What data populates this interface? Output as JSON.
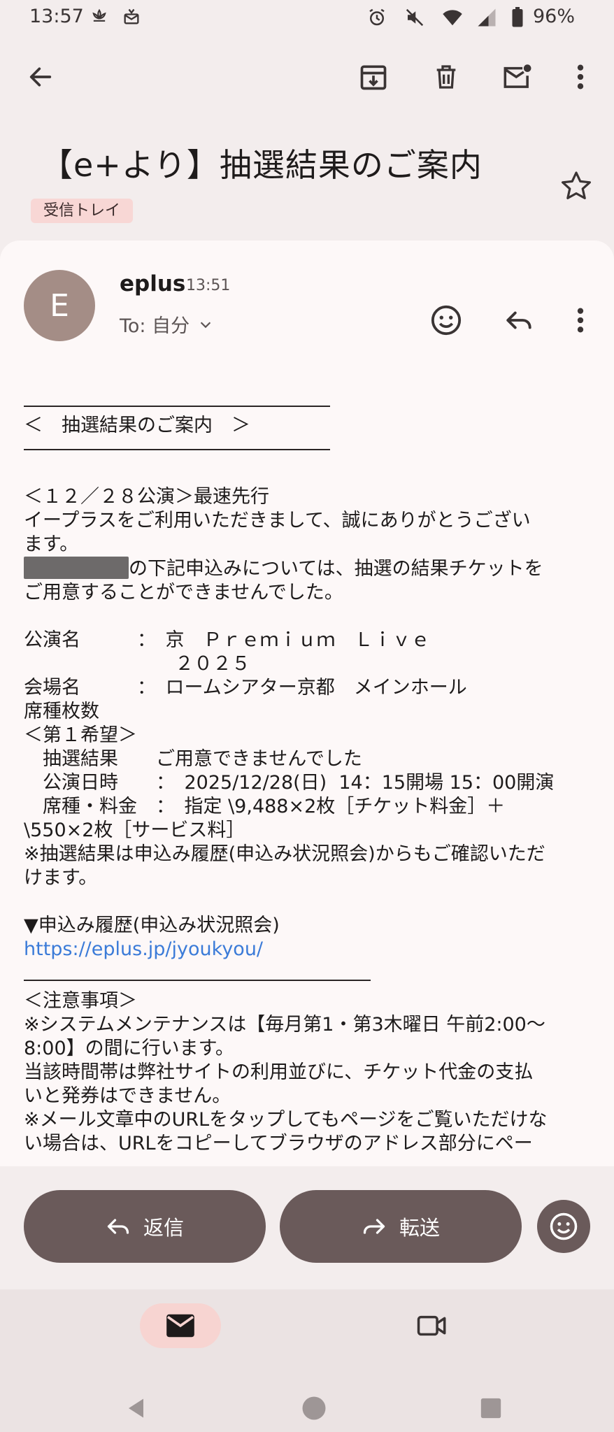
{
  "status_bar": {
    "time": "13:57",
    "battery_text": "96%",
    "icons": [
      "flower-icon",
      "notification-icon",
      "alarm-icon",
      "mute-icon",
      "wifi-icon",
      "signal-icon",
      "battery-icon"
    ]
  },
  "toolbar": {
    "icons": [
      "back-arrow-icon",
      "archive-icon",
      "delete-icon",
      "mark-unread-icon",
      "more-vert-icon"
    ]
  },
  "email": {
    "subject": "【e+より】抽選結果のご案内",
    "label": "受信トレイ",
    "sender_initial": "E",
    "sender": "eplus",
    "time": "13:51",
    "to": "To: 自分"
  },
  "body": {
    "heading": "＜　抽選結果のご案内　＞",
    "line_event_priority": "＜１２／２８公演＞最速先行",
    "line_thanks_1": "イープラスをご利用いただきまして、誠にありがとうござい",
    "line_thanks_2": "ます。",
    "line_result_1": "の下記申込みについては、抽選の結果チケットを",
    "line_result_2": "ご用意することができませんでした。",
    "line_show_name_1": "公演名　　　：　京　Ｐｒｅｍｉｕｍ　Ｌｉｖｅ",
    "line_show_name_2": "　　　　　　　　２０２５",
    "line_venue": "会場名　　　：　ロームシアター京都　メインホール",
    "line_seat_count": "席種枚数",
    "line_first_choice": "＜第１希望＞",
    "line_lottery": "　抽選結果　　ご用意できませんでした",
    "line_datetime": "　公演日時　　：　2025/12/28(日)  14：15開場 15：00開演",
    "line_seat_price": "　席種・料金　：　指定 \\9,488×2枚［チケット料金］＋",
    "line_service": "\\550×2枚［サービス料］",
    "line_note_1": "※抽選結果は申込み履歴(申込み状況照会)からもご確認いただ",
    "line_note_2": "けます。",
    "line_history": "▼申込み履歴(申込み状況照会)",
    "link": "https://eplus.jp/jyoukyou/",
    "line_notice_title": "＜注意事項＞",
    "line_notice_1": "※システムメンテナンスは【毎月第1・第3木曜日 午前2:00～",
    "line_notice_2": "8:00】の間に行います。",
    "line_notice_3": "当該時間帯は弊社サイトの利用並びに、チケット代金の支払",
    "line_notice_4": "いと発券はできません。",
    "line_notice_5": "※メール文章中のURLをタップしてもページをご覧いただけな",
    "line_notice_6": "い場合は、URLをコピーしてブラウザのアドレス部分にペー"
  },
  "actions": {
    "reply_label": "返信",
    "forward_label": "転送"
  },
  "bottom_nav": {
    "items": [
      "mail-icon",
      "video-icon"
    ]
  },
  "colors": {
    "background": "#f3eded",
    "card": "#fdf8f8",
    "pill": "#6a5a5a",
    "label_chip": "#f8d7d5",
    "link": "#3b7bd8"
  }
}
